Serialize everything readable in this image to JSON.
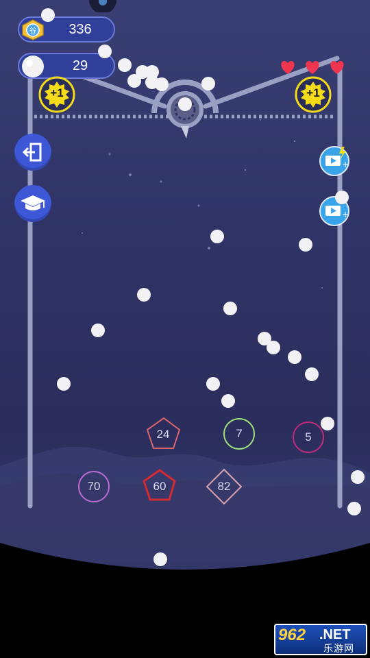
{
  "hud": {
    "coins": "336",
    "balls": "29",
    "lives": 3,
    "bonus_left": "+1",
    "bonus_right": "+1"
  },
  "buttons": {
    "exit_icon": "exit-icon",
    "tutorial_icon": "graduation-cap-icon",
    "video_bonus_icon": "video-ad-icon"
  },
  "shapes": [
    {
      "shape": "pentagon",
      "label": "24",
      "color": "#d9646f"
    },
    {
      "shape": "circle",
      "label": "7",
      "color": "#9ee07a"
    },
    {
      "shape": "circle",
      "label": "5",
      "color": "#c02a7a"
    },
    {
      "shape": "circle",
      "label": "70",
      "color": "#b86ad0"
    },
    {
      "shape": "pentagon",
      "label": "60",
      "color": "#d42a32"
    },
    {
      "shape": "diamond",
      "label": "82",
      "color": "#d9a3ae"
    }
  ],
  "watermark": {
    "digits": "962",
    "suffix": ".NET",
    "text_cn": "乐游网"
  },
  "colors": {
    "accent": "#3d57d6",
    "pill_bg": "#2f3f9a",
    "badge_yellow": "#f5dc1b",
    "heart": "#f0364f"
  }
}
